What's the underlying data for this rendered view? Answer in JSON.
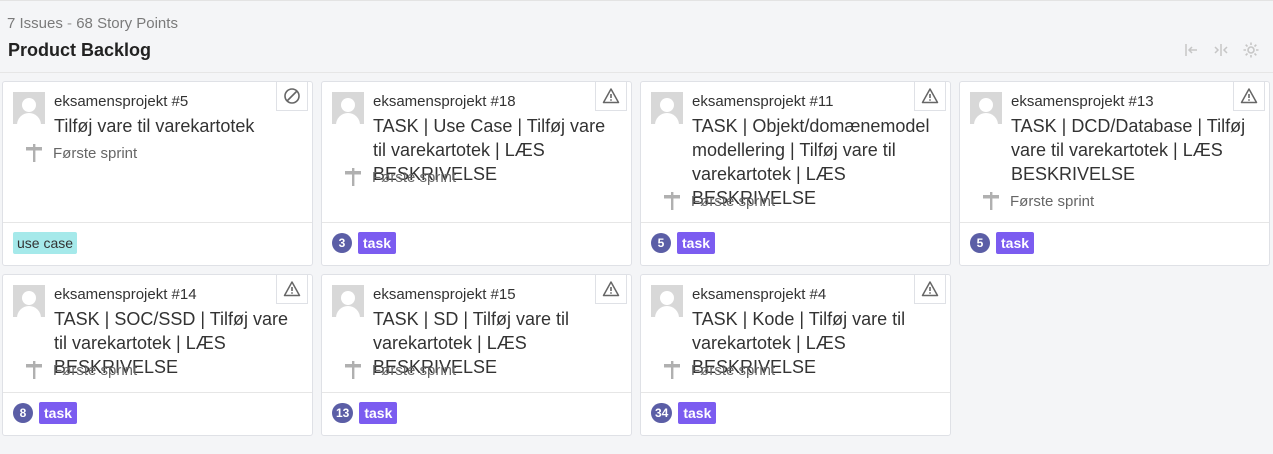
{
  "summary": {
    "issues": "7 Issues",
    "separator": "-",
    "points": "68 Story Points"
  },
  "board_title": "Product Backlog",
  "tools": [
    "collapse-left-icon",
    "collapse-columns-icon",
    "gear-icon"
  ],
  "colors": {
    "task_label": "#7b5cf0",
    "usecase_label": "#a5e9ea",
    "points_badge": "#5b5ea6"
  },
  "cards": [
    {
      "project": "eksamensprojekt #5",
      "title": "Tilføj vare til varekartotek",
      "sprint": "Første sprint",
      "flag": "blocked-icon",
      "points": "",
      "label": "use case"
    },
    {
      "project": "eksamensprojekt #18",
      "title": "TASK | Use Case | Tilføj vare til varekartotek | LÆS BESKRIVELSE",
      "sprint": "Første sprint",
      "flag": "warning-icon",
      "points": "3",
      "label": "task"
    },
    {
      "project": "eksamensprojekt #11",
      "title": "TASK | Objekt/domænemodel modellering | Tilføj vare til varekartotek | LÆS BESKRIVELSE",
      "sprint": "Første sprint",
      "flag": "warning-icon",
      "points": "5",
      "label": "task"
    },
    {
      "project": "eksamensprojekt #13",
      "title": "TASK | DCD/Database | Tilføj vare til varekartotek | LÆS BESKRIVELSE",
      "sprint": "Første sprint",
      "flag": "warning-icon",
      "points": "5",
      "label": "task"
    },
    {
      "project": "eksamensprojekt #14",
      "title": "TASK | SOC/SSD | Tilføj vare til varekartotek | LÆS BESKRIVELSE",
      "sprint": "Første sprint",
      "flag": "warning-icon",
      "points": "8",
      "label": "task"
    },
    {
      "project": "eksamensprojekt #15",
      "title": "TASK | SD | Tilføj vare til varekartotek | LÆS BESKRIVELSE",
      "sprint": "Første sprint",
      "flag": "warning-icon",
      "points": "13",
      "label": "task"
    },
    {
      "project": "eksamensprojekt #4",
      "title": "TASK | Kode | Tilføj vare til varekartotek | LÆS BESKRIVELSE",
      "sprint": "Første sprint",
      "flag": "warning-icon",
      "points": "34",
      "label": "task"
    }
  ]
}
